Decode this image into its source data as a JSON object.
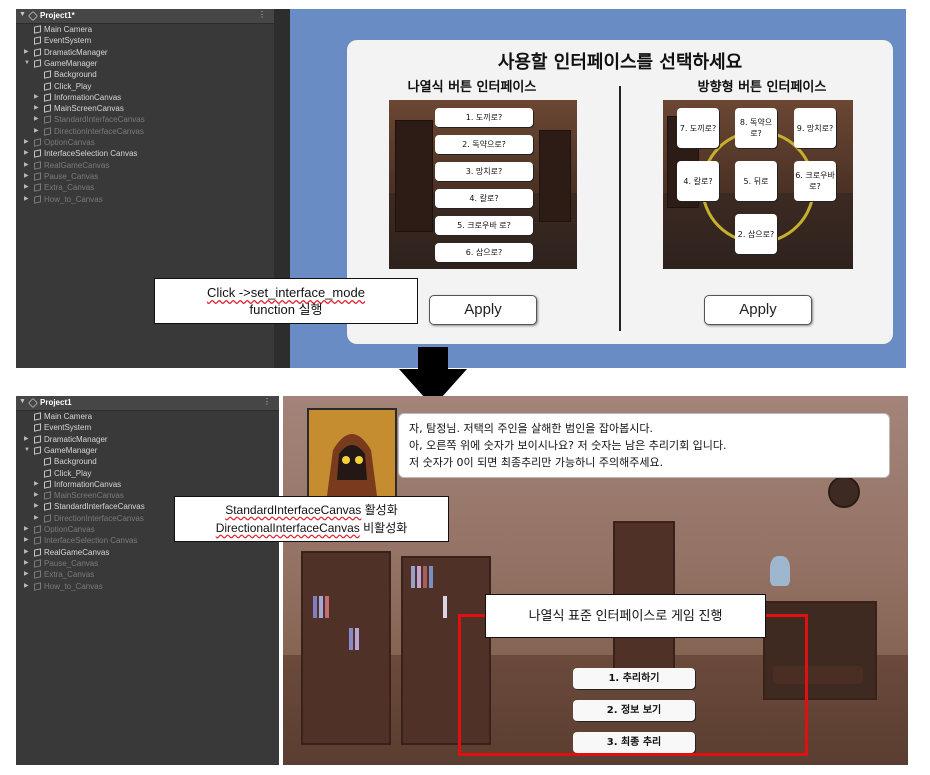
{
  "top_hierarchy": {
    "project": "Project1*",
    "items": [
      {
        "label": "Main Camera",
        "depth": 1,
        "toggle": "",
        "dim": false
      },
      {
        "label": "EventSystem",
        "depth": 1,
        "toggle": "",
        "dim": false
      },
      {
        "label": "DramaticManager",
        "depth": 1,
        "toggle": "▶",
        "dim": false
      },
      {
        "label": "GameManager",
        "depth": 1,
        "toggle": "▼",
        "dim": false
      },
      {
        "label": "Background",
        "depth": 2,
        "toggle": "",
        "dim": false
      },
      {
        "label": "Click_Play",
        "depth": 2,
        "toggle": "",
        "dim": false
      },
      {
        "label": "InformationCanvas",
        "depth": 2,
        "toggle": "▶",
        "dim": false
      },
      {
        "label": "MainScreenCanvas",
        "depth": 2,
        "toggle": "▶",
        "dim": false
      },
      {
        "label": "StandardInterfaceCanvas",
        "depth": 2,
        "toggle": "▶",
        "dim": true
      },
      {
        "label": "DirectionInterfaceCanvas",
        "depth": 2,
        "toggle": "▶",
        "dim": true
      },
      {
        "label": "OptionCanvas",
        "depth": 1,
        "toggle": "▶",
        "dim": true
      },
      {
        "label": "InterfaceSelection Canvas",
        "depth": 1,
        "toggle": "▶",
        "dim": false
      },
      {
        "label": "RealGameCanvas",
        "depth": 1,
        "toggle": "▶",
        "dim": true
      },
      {
        "label": "Pause_Canvas",
        "depth": 1,
        "toggle": "▶",
        "dim": true
      },
      {
        "label": "Extra_Canvas",
        "depth": 1,
        "toggle": "▶",
        "dim": true
      },
      {
        "label": "How_to_Canvas",
        "depth": 1,
        "toggle": "▶",
        "dim": true
      }
    ]
  },
  "bottom_hierarchy": {
    "project": "Project1",
    "items": [
      {
        "label": "Main Camera",
        "depth": 1,
        "toggle": "",
        "dim": false
      },
      {
        "label": "EventSystem",
        "depth": 1,
        "toggle": "",
        "dim": false
      },
      {
        "label": "DramaticManager",
        "depth": 1,
        "toggle": "▶",
        "dim": false
      },
      {
        "label": "GameManager",
        "depth": 1,
        "toggle": "▼",
        "dim": false
      },
      {
        "label": "Background",
        "depth": 2,
        "toggle": "",
        "dim": false
      },
      {
        "label": "Click_Play",
        "depth": 2,
        "toggle": "",
        "dim": false
      },
      {
        "label": "InformationCanvas",
        "depth": 2,
        "toggle": "▶",
        "dim": false
      },
      {
        "label": "MainScreenCanvas",
        "depth": 2,
        "toggle": "▶",
        "dim": true
      },
      {
        "label": "StandardInterfaceCanvas",
        "depth": 2,
        "toggle": "▶",
        "dim": false
      },
      {
        "label": "DirectionInterfaceCanvas",
        "depth": 2,
        "toggle": "▶",
        "dim": true
      },
      {
        "label": "OptionCanvas",
        "depth": 1,
        "toggle": "▶",
        "dim": true
      },
      {
        "label": "InterfaceSelection Canvas",
        "depth": 1,
        "toggle": "▶",
        "dim": true
      },
      {
        "label": "RealGameCanvas",
        "depth": 1,
        "toggle": "▶",
        "dim": false
      },
      {
        "label": "Pause_Canvas",
        "depth": 1,
        "toggle": "▶",
        "dim": true
      },
      {
        "label": "Extra_Canvas",
        "depth": 1,
        "toggle": "▶",
        "dim": true
      },
      {
        "label": "How_to_Canvas",
        "depth": 1,
        "toggle": "▶",
        "dim": true
      }
    ]
  },
  "selection_panel": {
    "title": "사용할 인터페이스를 선택하세요",
    "standard": {
      "title": "나열식 버튼 인터페이스",
      "buttons": [
        "1. 도끼로?",
        "2. 독약으로?",
        "3. 망치로?",
        "4. 칼로?",
        "5. 크로우바 로?",
        "6. 삽으로?"
      ],
      "apply": "Apply"
    },
    "directional": {
      "title": "방향형 버튼 인터페이스",
      "buttons": {
        "b7": "7. 도끼로?",
        "b8": "8. 독약으로?",
        "b9": "9. 망치로?",
        "b4": "4. 칼로?",
        "b5": "5. 뒤로",
        "b6": "6. 크로우바 로?",
        "b2": "2. 삽으로?"
      },
      "apply": "Apply"
    }
  },
  "notes": {
    "click_line1": "Click ->set_interface_mode",
    "click_line2": "function 실행",
    "canvas_line1_name": "StandardInterfaceCanvas",
    "canvas_line1_suffix": " 활성화",
    "canvas_line2_name": "DirectionalInterfaceCanvas",
    "canvas_line2_suffix": " 비활성화",
    "game_note": "나열식 표준 인터페이스로 게임 진행"
  },
  "game": {
    "dialog": [
      "자, 탐정님. 저택의 주인을 살해한 범인을 잡아봅시다.",
      "아, 오른쪽 위에 숫자가 보이시나요? 저 숫자는 남은 추리기회 입니다.",
      "저 숫자가 0이 되면 최종추리만 가능하니 주의해주세요."
    ],
    "buttons": [
      "1. 추리하기",
      "2. 정보 보기",
      "3. 최종 추리"
    ]
  },
  "colors": {
    "highlight_box": "#e01010",
    "game_view_bg": "#6a8cc4",
    "hierarchy_bg": "#393939"
  }
}
